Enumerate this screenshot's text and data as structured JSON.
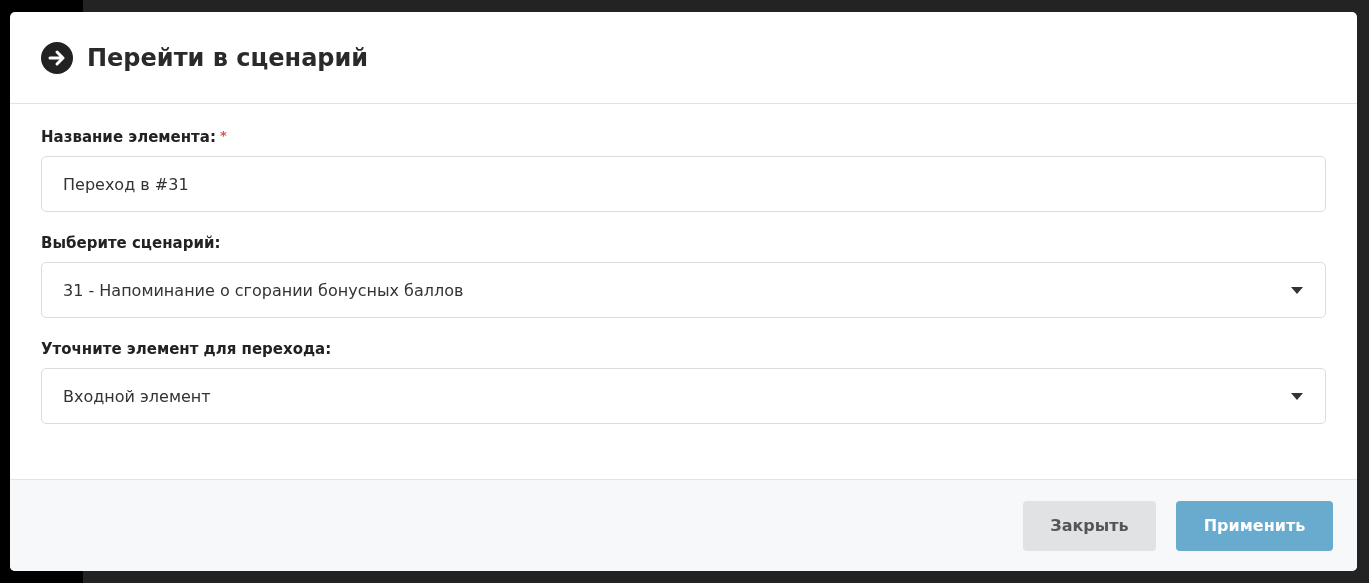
{
  "dialog": {
    "title": "Перейти в сценарий"
  },
  "fields": [
    {
      "kind": "text",
      "label": "Название элемента:",
      "required_mark": "*",
      "value": "Переход в #31"
    },
    {
      "kind": "select",
      "label": "Выберите сценарий:",
      "value": "31 - Напоминание о сгорании бонусных баллов"
    },
    {
      "kind": "select",
      "label": "Уточните элемент для перехода:",
      "value": "Входной элемент"
    }
  ],
  "buttons": [
    {
      "kind": "secondary",
      "label": "Закрыть"
    },
    {
      "kind": "primary",
      "label": "Применить"
    }
  ]
}
